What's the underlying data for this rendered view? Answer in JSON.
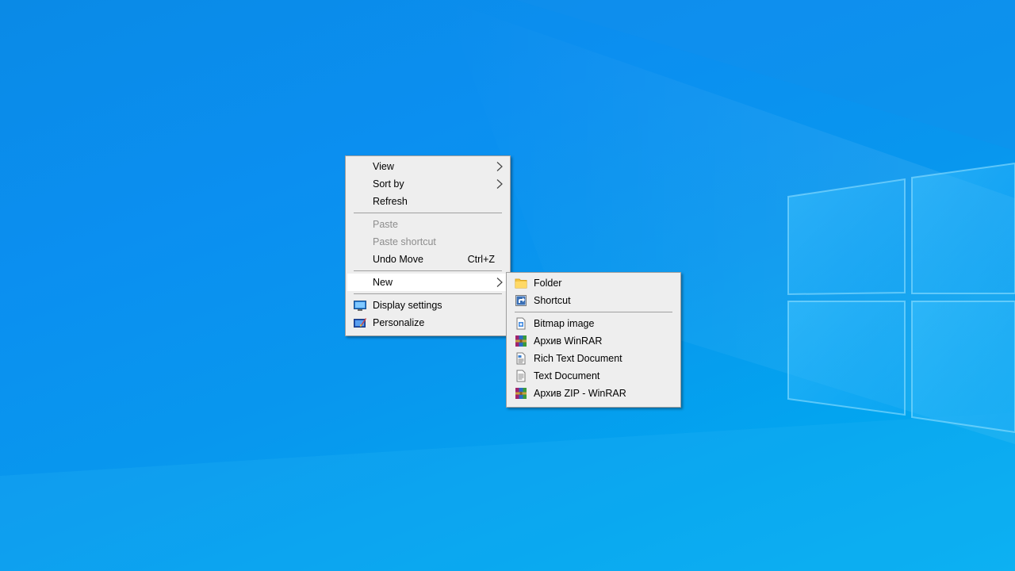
{
  "desktop": {
    "accent": "#0a8ae6"
  },
  "context_menu": {
    "items": [
      {
        "label": "View",
        "has_submenu": true
      },
      {
        "label": "Sort by",
        "has_submenu": true
      },
      {
        "label": "Refresh"
      },
      {
        "label": "Paste",
        "disabled": true
      },
      {
        "label": "Paste shortcut",
        "disabled": true
      },
      {
        "label": "Undo Move",
        "shortcut": "Ctrl+Z"
      },
      {
        "label": "New",
        "has_submenu": true,
        "highlighted": true
      },
      {
        "label": "Display settings",
        "icon": "display-icon"
      },
      {
        "label": "Personalize",
        "icon": "personalize-icon"
      }
    ]
  },
  "new_submenu": {
    "items": [
      {
        "label": "Folder",
        "icon": "folder-icon"
      },
      {
        "label": "Shortcut",
        "icon": "shortcut-icon"
      },
      {
        "label": "Bitmap image",
        "icon": "bitmap-icon"
      },
      {
        "label": "Архив WinRAR",
        "icon": "winrar-icon"
      },
      {
        "label": "Rich Text Document",
        "icon": "rich-text-icon"
      },
      {
        "label": "Text Document",
        "icon": "text-document-icon"
      },
      {
        "label": "Архив ZIP - WinRAR",
        "icon": "winrar-zip-icon"
      }
    ]
  }
}
